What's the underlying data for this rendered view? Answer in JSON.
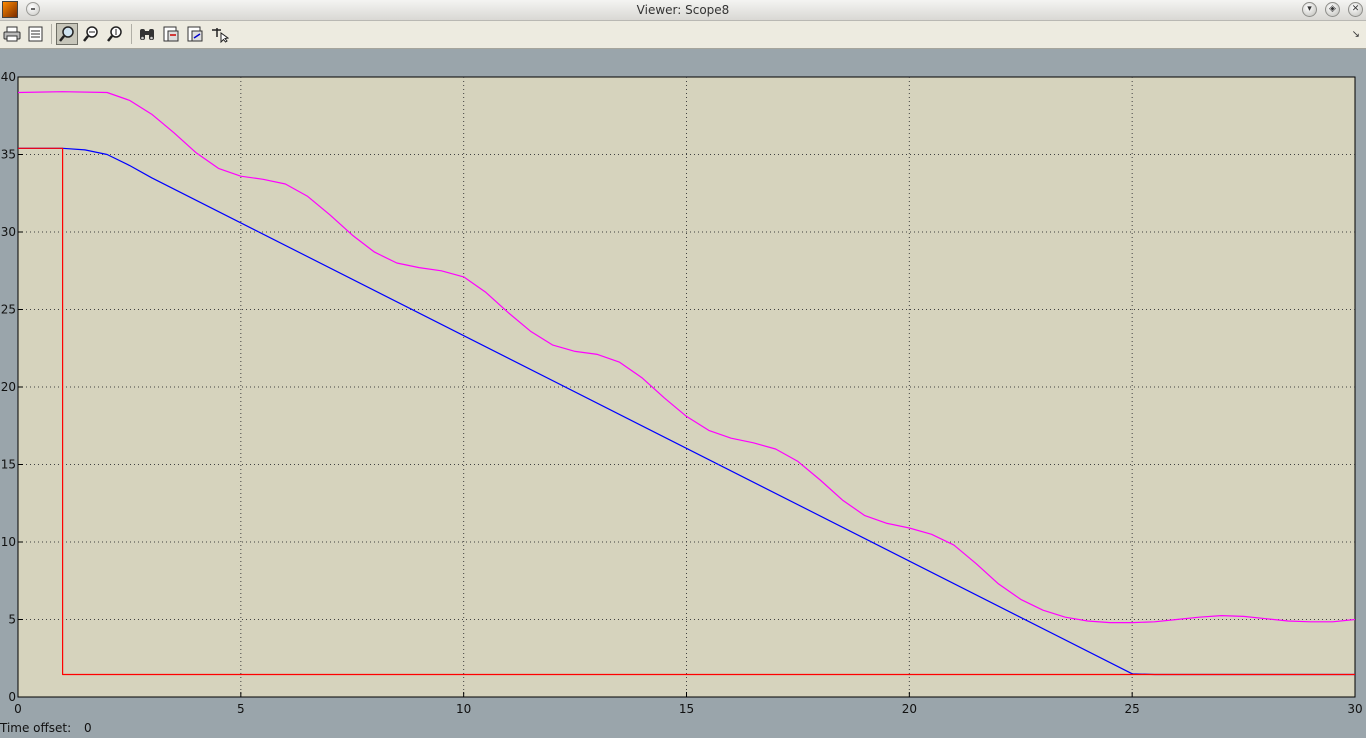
{
  "window": {
    "title": "Viewer: Scope8"
  },
  "toolbar": {
    "buttons": [
      "print",
      "parameters",
      "zoom",
      "zoom-x-axis",
      "zoom-y-axis",
      "autoscale",
      "save-axes-settings",
      "restore-axes-settings",
      "signal-selection"
    ]
  },
  "colors": {
    "background": "#9aa5ab",
    "axes_bg": "#d6d3bd",
    "grid": "#404040",
    "series1": "#ff00ff",
    "series2": "#0000ff",
    "series3": "#ff0000"
  },
  "status": {
    "label": "Time offset:",
    "value": "0"
  },
  "chart_data": {
    "type": "line",
    "title": "",
    "xlabel": "",
    "ylabel": "",
    "xlim": [
      0,
      30
    ],
    "ylim": [
      0,
      40
    ],
    "xticks": [
      0,
      5,
      10,
      15,
      20,
      25,
      30
    ],
    "yticks": [
      0,
      5,
      10,
      15,
      20,
      25,
      30,
      35,
      40
    ],
    "grid": true,
    "series": [
      {
        "color": "#ff00ff",
        "x": [
          0,
          1,
          2,
          2.5,
          3,
          3.5,
          4,
          4.5,
          5,
          5.5,
          6,
          6.5,
          7,
          7.5,
          8,
          8.5,
          9,
          9.5,
          10,
          10.5,
          11,
          11.5,
          12,
          12.5,
          13,
          13.5,
          14,
          14.5,
          15,
          15.5,
          16,
          16.5,
          17,
          17.5,
          18,
          18.5,
          19,
          19.5,
          20,
          20.5,
          21,
          21.5,
          22,
          22.5,
          23,
          23.5,
          24,
          24.5,
          25,
          25.5,
          26,
          26.5,
          27,
          27.5,
          28,
          28.5,
          29,
          29.5,
          30
        ],
        "y": [
          39,
          39.05,
          39,
          38.5,
          37.6,
          36.4,
          35.1,
          34.1,
          33.6,
          33.4,
          33.1,
          32.3,
          31.1,
          29.8,
          28.7,
          28.0,
          27.7,
          27.5,
          27.1,
          26.1,
          24.8,
          23.6,
          22.7,
          22.3,
          22.1,
          21.6,
          20.6,
          19.3,
          18.1,
          17.2,
          16.7,
          16.4,
          16.0,
          15.2,
          14.0,
          12.7,
          11.7,
          11.2,
          10.9,
          10.5,
          9.8,
          8.6,
          7.3,
          6.3,
          5.6,
          5.15,
          4.9,
          4.8,
          4.8,
          4.85,
          5.0,
          5.15,
          5.25,
          5.2,
          5.05,
          4.9,
          4.85,
          4.85,
          5.0
        ]
      },
      {
        "color": "#0000ff",
        "x": [
          0,
          1,
          1.5,
          2,
          2.5,
          3,
          25,
          25.5,
          26,
          30
        ],
        "y": [
          35.4,
          35.4,
          35.3,
          35.0,
          34.3,
          33.5,
          1.5,
          1.45,
          1.45,
          1.45
        ]
      },
      {
        "color": "#ff0000",
        "x": [
          0,
          1,
          1,
          30
        ],
        "y": [
          35.4,
          35.4,
          1.45,
          1.45
        ]
      }
    ]
  }
}
